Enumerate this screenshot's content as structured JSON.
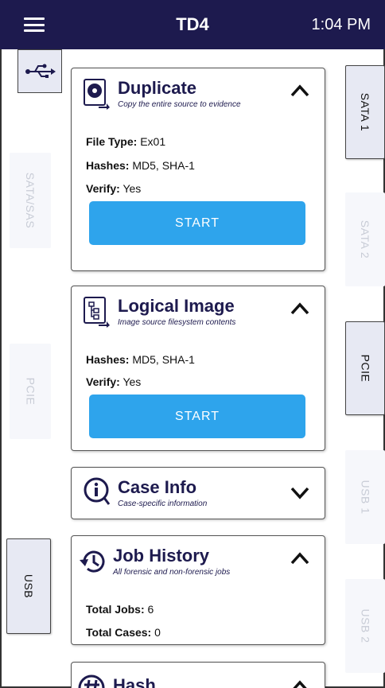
{
  "header": {
    "title": "TD4",
    "time": "1:04 PM"
  },
  "left_tabs": [
    {
      "label": "SATA/SAS",
      "state": "inactive"
    },
    {
      "label": "PCIE",
      "state": "inactive"
    },
    {
      "label": "USB",
      "state": "active"
    }
  ],
  "right_tabs": [
    {
      "label": "SATA 1",
      "state": "active"
    },
    {
      "label": "SATA 2",
      "state": "inactive"
    },
    {
      "label": "PCIE",
      "state": "active"
    },
    {
      "label": "USB 1",
      "state": "inactive"
    },
    {
      "label": "USB 2",
      "state": "inactive"
    }
  ],
  "cards": {
    "duplicate": {
      "title": "Duplicate",
      "subtitle": "Copy the entire source to evidence",
      "rows": [
        {
          "key": "File Type:",
          "value": " Ex01"
        },
        {
          "key": "Hashes:",
          "value": " MD5, SHA-1"
        },
        {
          "key": "Verify:",
          "value": " Yes"
        }
      ],
      "button": "START"
    },
    "logical": {
      "title": "Logical Image",
      "subtitle": "Image source filesystem contents",
      "rows": [
        {
          "key": "Hashes:",
          "value": " MD5, SHA-1"
        },
        {
          "key": "Verify:",
          "value": " Yes"
        }
      ],
      "button": "START"
    },
    "case_info": {
      "title": "Case Info",
      "subtitle": "Case-specific information"
    },
    "job_history": {
      "title": "Job History",
      "subtitle": "All forensic and non-forensic jobs",
      "rows": [
        {
          "key": "Total Jobs:",
          "value": " 6"
        },
        {
          "key": "Total Cases:",
          "value": " 0"
        }
      ]
    },
    "hash": {
      "title": "Hash"
    }
  },
  "colors": {
    "header_bg": "#1d1a4e",
    "accent": "#2ea4ec",
    "title": "#1d1a4e"
  }
}
